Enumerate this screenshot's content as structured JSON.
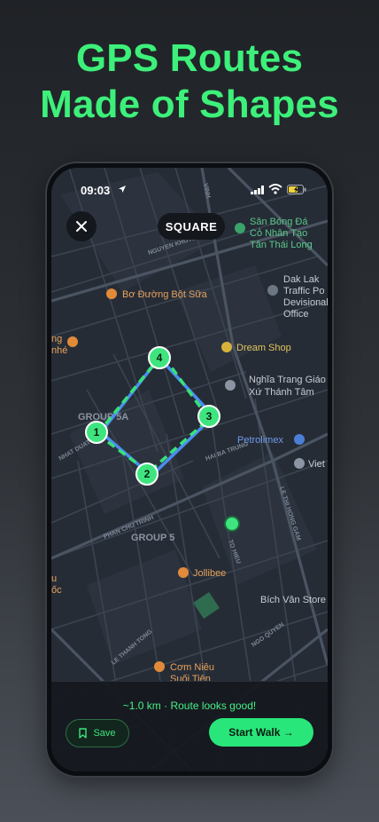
{
  "promo": {
    "line1": "GPS Routes",
    "line2": "Made of Shapes"
  },
  "status": {
    "time": "09:03",
    "icons": [
      "location-arrow-icon",
      "signal-icon",
      "wifi-icon",
      "battery-icon"
    ]
  },
  "header": {
    "close_icon": "close-icon",
    "shape_label": "SQUARE"
  },
  "map": {
    "pois": [
      {
        "name": "Sân Bóng Đá",
        "line2": "Cỏ Nhân Tạo",
        "line3": "Tân Thái Long"
      },
      {
        "name": "Dak Lak",
        "line2": "Traffic Po",
        "line3": "Devisional",
        "line4": "Office"
      },
      {
        "name": "Bơ Đường Bột Sữa"
      },
      {
        "name": "Dream Shop"
      },
      {
        "name": "Nghĩa Trang Giáo",
        "line2": "Xứ Thánh Tâm"
      },
      {
        "name": "Petrolimex"
      },
      {
        "name": "Viet"
      },
      {
        "name": "Jollibee"
      },
      {
        "name": "Bích Vân Store"
      },
      {
        "name": "Cơm Niêu",
        "line2": "Suối Tiên"
      },
      {
        "name": "ng",
        "line2": "nhé"
      },
      {
        "name": "u",
        "line2": "ốc"
      }
    ],
    "areas": [
      "GROUP 5A",
      "GROUP 5"
    ],
    "streets": [
      "NGUYEN KHUYEN",
      "PHAN CHU TRINH",
      "LE THANH TONG",
      "NGO QUYEN",
      "LE THI HONG GAM",
      "TO HIEU",
      "HAI BA TRUNG",
      "NHAT DUAT",
      "VINH"
    ],
    "waypoints": [
      "1",
      "2",
      "3",
      "4"
    ],
    "colors": {
      "route_planned": "#4b8df0",
      "route_shape": "#36e27a",
      "waypoint": "#3ee57f"
    }
  },
  "panel": {
    "summary": "~1.0 km · Route looks good!",
    "save_label": "Save",
    "start_label": "Start Walk →"
  }
}
